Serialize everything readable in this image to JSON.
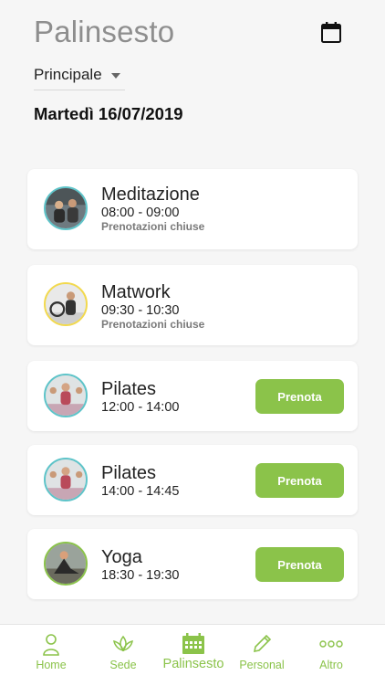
{
  "header": {
    "title": "Palinsesto",
    "location_select": {
      "selected": "Principale"
    },
    "date": "Martedì 16/07/2019"
  },
  "classes": [
    {
      "name": "Meditazione",
      "time": "08:00 - 09:00",
      "status": "Prenotazioni chiuse",
      "book_label": "",
      "avatar_ring": "#5ec4c9"
    },
    {
      "name": "Matwork",
      "time": "09:30 - 10:30",
      "status": "Prenotazioni chiuse",
      "book_label": "",
      "avatar_ring": "#f2d94e"
    },
    {
      "name": "Pilates",
      "time": "12:00 - 14:00",
      "status": "",
      "book_label": "Prenota",
      "avatar_ring": "#5ec4c9"
    },
    {
      "name": "Pilates",
      "time": "14:00 - 14:45",
      "status": "",
      "book_label": "Prenota",
      "avatar_ring": "#5ec4c9"
    },
    {
      "name": "Yoga",
      "time": "18:30 - 19:30",
      "status": "",
      "book_label": "Prenota",
      "avatar_ring": "#8bc34a"
    }
  ],
  "tabbar": {
    "items": [
      {
        "label": "Home",
        "icon": "person-icon"
      },
      {
        "label": "Sede",
        "icon": "lotus-icon"
      },
      {
        "label": "Palinsesto",
        "icon": "calendar-icon",
        "active": true
      },
      {
        "label": "Personal",
        "icon": "pencil-icon"
      },
      {
        "label": "Altro",
        "icon": "more-dots-icon"
      }
    ]
  },
  "colors": {
    "accent": "#8bc34a",
    "title_gray": "#8e8e8e",
    "background": "#f6f6f6"
  }
}
